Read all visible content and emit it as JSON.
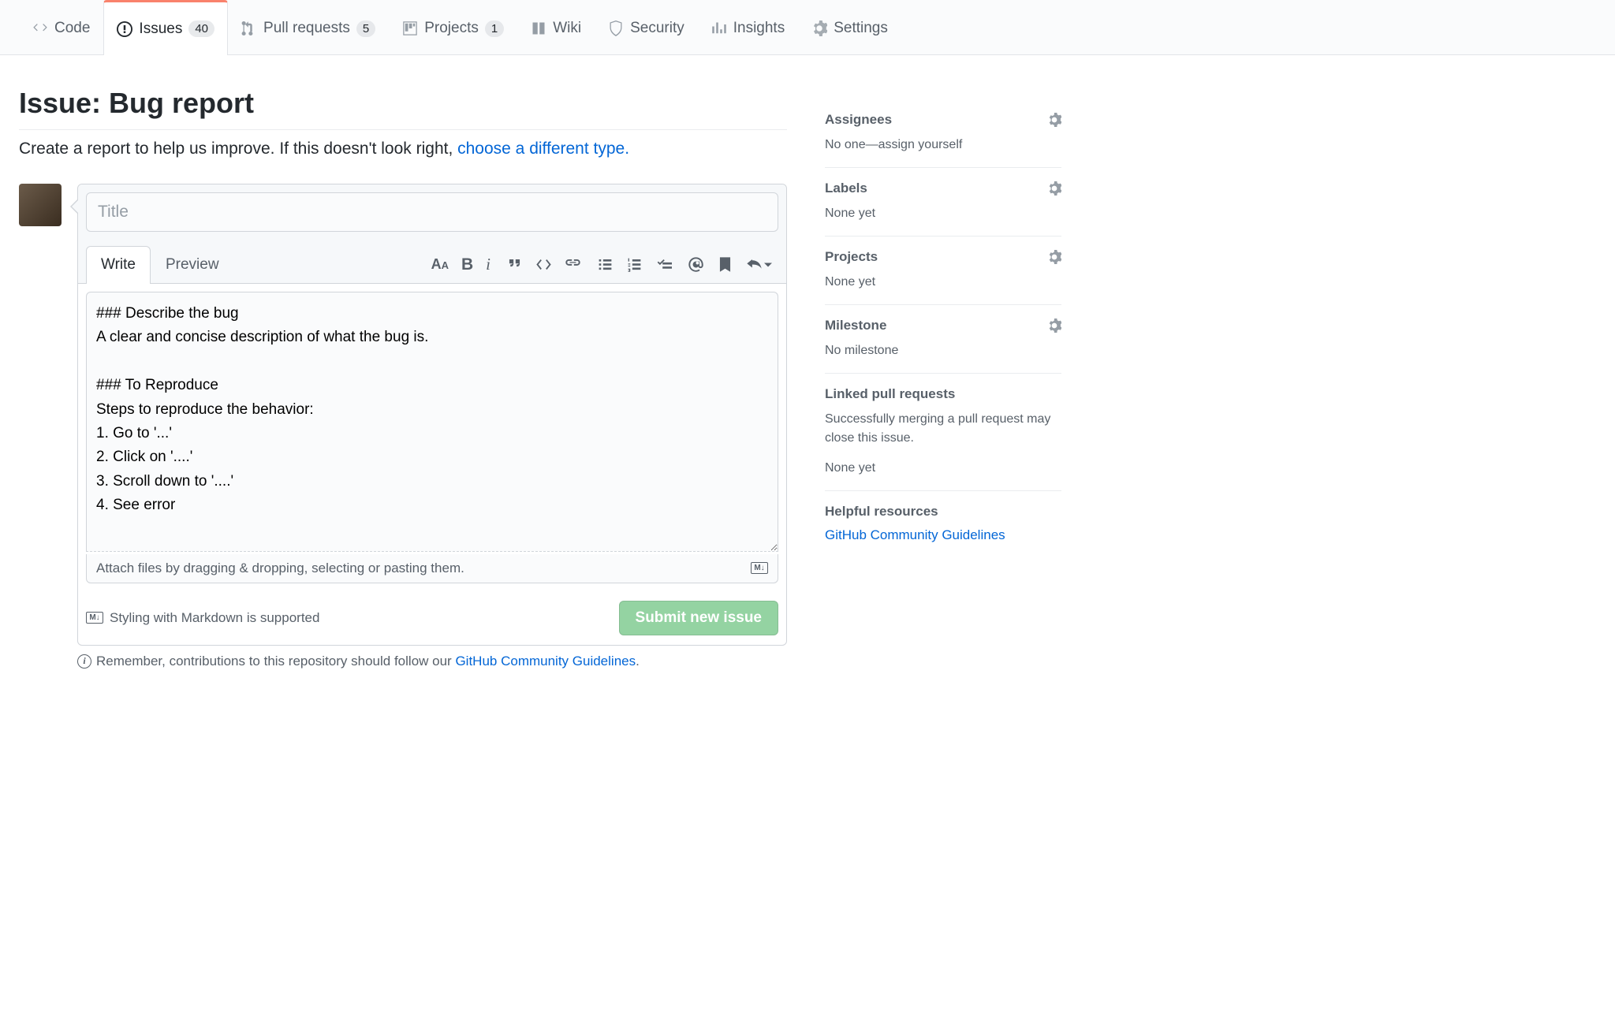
{
  "nav": {
    "tabs": [
      {
        "label": "Code"
      },
      {
        "label": "Issues",
        "count": "40"
      },
      {
        "label": "Pull requests",
        "count": "5"
      },
      {
        "label": "Projects",
        "count": "1"
      },
      {
        "label": "Wiki"
      },
      {
        "label": "Security"
      },
      {
        "label": "Insights"
      },
      {
        "label": "Settings"
      }
    ]
  },
  "page": {
    "title": "Issue: Bug report",
    "subtitle_text": "Create a report to help us improve. If this doesn't look right, ",
    "subtitle_link": "choose a different type."
  },
  "editor": {
    "title_placeholder": "Title",
    "tab_write": "Write",
    "tab_preview": "Preview",
    "body_value": "### Describe the bug\nA clear and concise description of what the bug is.\n\n### To Reproduce\nSteps to reproduce the behavior:\n1. Go to '...'\n2. Click on '....'\n3. Scroll down to '....'\n4. See error\n",
    "attach_hint": "Attach files by dragging & dropping, selecting or pasting them.",
    "md_hint": "Styling with Markdown is supported",
    "submit_label": "Submit new issue",
    "contrib_prefix": "Remember, contributions to this repository should follow our ",
    "contrib_link": "GitHub Community Guidelines"
  },
  "sidebar": {
    "assignees": {
      "title": "Assignees",
      "body": "No one—assign yourself"
    },
    "labels": {
      "title": "Labels",
      "body": "None yet"
    },
    "projects": {
      "title": "Projects",
      "body": "None yet"
    },
    "milestone": {
      "title": "Milestone",
      "body": "No milestone"
    },
    "linked": {
      "title": "Linked pull requests",
      "desc": "Successfully merging a pull request may close this issue.",
      "body": "None yet"
    },
    "resources": {
      "title": "Helpful resources",
      "link": "GitHub Community Guidelines"
    }
  }
}
